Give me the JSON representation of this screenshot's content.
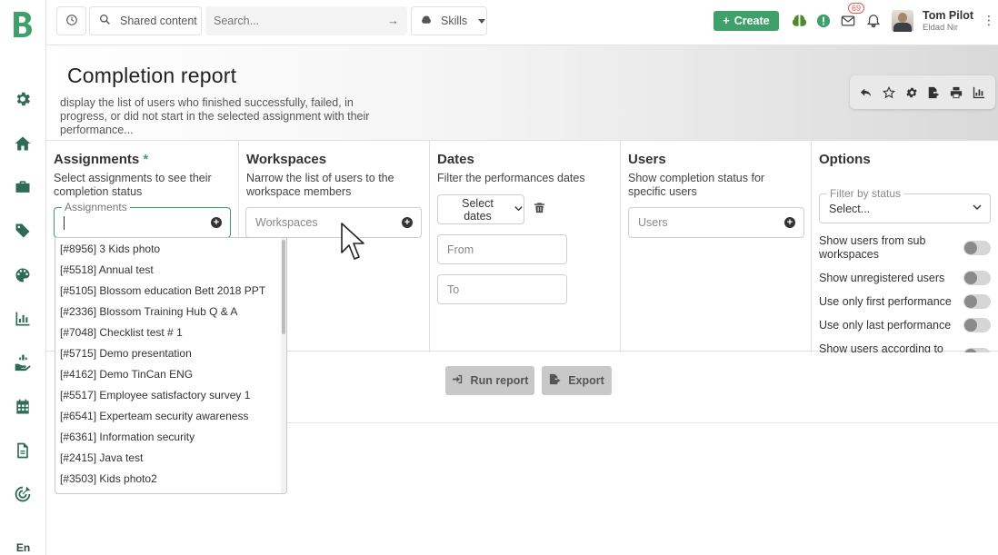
{
  "sidebar": {
    "logo": "B",
    "items": [
      {
        "name": "settings-icon"
      },
      {
        "name": "home-icon"
      },
      {
        "name": "briefcase-icon"
      },
      {
        "name": "tags-icon"
      },
      {
        "name": "palette-icon"
      },
      {
        "name": "reports-icon"
      },
      {
        "name": "hand-icon"
      },
      {
        "name": "calendar-icon"
      },
      {
        "name": "document-icon"
      },
      {
        "name": "target-icon"
      }
    ],
    "language": "En"
  },
  "topbar": {
    "shared_label": "Shared content",
    "search_placeholder": "Search...",
    "skills_label": "Skills",
    "create_label": "Create",
    "notification_count": "69",
    "user_name": "Tom Pilot",
    "user_subtitle": "Eldad Nir"
  },
  "header": {
    "title": "Completion report",
    "description": "display the list of users who finished successfully, failed, in progress, or did not start in the selected assignment with their performance..."
  },
  "columns": {
    "assignments": {
      "title": "Assignments",
      "required_mark": "*",
      "subtitle": "Select assignments to see their completion status",
      "field_label": "Assignments"
    },
    "workspaces": {
      "title": "Workspaces",
      "subtitle": "Narrow the list of users to the workspace members",
      "placeholder": "Workspaces"
    },
    "dates": {
      "title": "Dates",
      "subtitle": "Filter the performances dates",
      "select_label": "Select dates",
      "from_placeholder": "From",
      "to_placeholder": "To"
    },
    "users": {
      "title": "Users",
      "subtitle": "Show completion status for specific users",
      "placeholder": "Users"
    },
    "options": {
      "title": "Options",
      "status_label": "Filter by status",
      "status_value": "Select...",
      "toggles": [
        "Show users from sub workspaces",
        "Show unregistered users",
        "Use only first performance",
        "Use only last performance",
        "Show users according to"
      ]
    }
  },
  "actions": {
    "run_label": "Run report",
    "export_label": "Export"
  },
  "dropdown_items": [
    "[#8956] 3 Kids photo",
    "[#5518] Annual test",
    "[#5105] Blossom education Bett 2018 PPT",
    "[#2336] Blossom Training Hub Q & A",
    "[#7048] Checklist test # 1",
    "[#5715] Demo presentation",
    "[#4162] Demo TinCan ENG",
    "[#5517] Employee satisfactory survey 1",
    "[#6541] Experteam security awareness",
    "[#6361] Information security",
    "[#2415] Java test",
    "[#3503] Kids photo2"
  ],
  "colors": {
    "brand_green": "#3fa06a",
    "sidebar_icon": "#2d6b57",
    "notification_red": "#e05a4f"
  }
}
